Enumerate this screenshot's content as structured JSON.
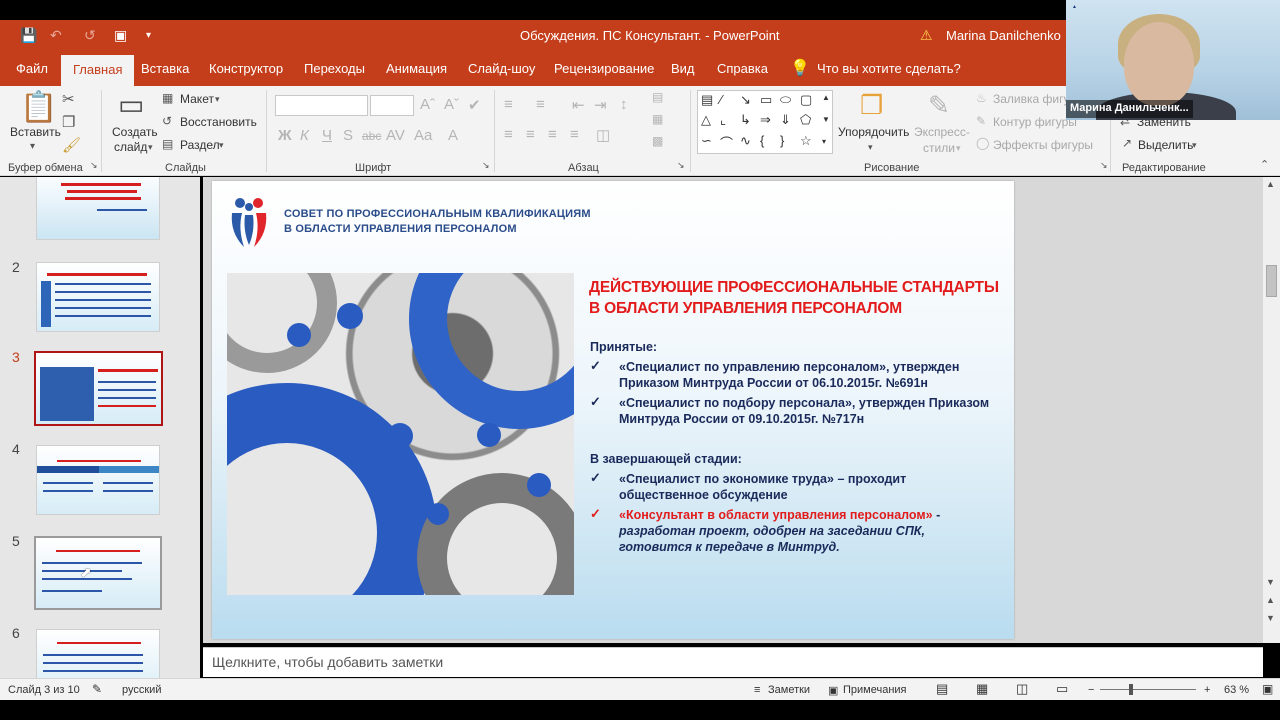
{
  "window": {
    "title": "Обсуждения. ПС Консультант.  -  PowerPoint",
    "user": "Marina Danilchenko"
  },
  "tabs": [
    "Файл",
    "Главная",
    "Вставка",
    "Конструктор",
    "Переходы",
    "Анимация",
    "Слайд-шоу",
    "Рецензирование",
    "Вид",
    "Справка"
  ],
  "tellme": "Что вы хотите сделать?",
  "ribbon": {
    "paste": "Вставить",
    "clipboard_group": "Буфер обмена",
    "new_slide_1": "Создать",
    "new_slide_2": "слайд",
    "layout": "Макет",
    "reset": "Восстановить",
    "section": "Раздел",
    "slides_group": "Слайды",
    "font_group": "Шрифт",
    "paragraph_group": "Абзац",
    "arrange_1": "Упорядочить",
    "quick_styles_1": "Экспресс-",
    "quick_styles_2": "стили",
    "shape_fill": "Заливка фигуры",
    "shape_outline": "Контур фигуры",
    "shape_effects": "Эффекты фигуры",
    "drawing_group": "Рисование",
    "replace": "Заменить",
    "select": "Выделить",
    "editing_group": "Редактирование"
  },
  "webcam": {
    "name": "Марина Данильченк..."
  },
  "thumbnails": [
    {
      "num": "2"
    },
    {
      "num": "3"
    },
    {
      "num": "4"
    },
    {
      "num": "5"
    },
    {
      "num": "6"
    }
  ],
  "slide": {
    "org_line1": "СОВЕТ ПО ПРОФЕССИОНАЛЬНЫМ КВАЛИФИКАЦИЯМ",
    "org_line2": "В ОБЛАСТИ УПРАВЛЕНИЯ ПЕРСОНАЛОМ",
    "heading_line1": "ДЕЙСТВУЮЩИЕ ПРОФЕССИОНАЛЬНЫЕ СТАНДАРТЫ",
    "heading_line2": "В ОБЛАСТИ УПРАВЛЕНИЯ ПЕРСОНАЛОМ",
    "adopted_label": "Принятые:",
    "item1": "«Специалист по управлению персоналом», утвержден Приказом Минтруда России от 06.10.2015г. №691н",
    "item2": "«Специалист по подбору персонала», утвержден Приказом Минтруда России от 09.10.2015г. №717н",
    "final_label": "В завершающей стадии:",
    "item3": "«Специалист по экономике труда» – проходит общественное обсуждение",
    "item4_red": "«Консультант в области управления персоналом»",
    "item4_dash": " -",
    "item4_rest": "разработан проект, одобрен на заседании СПК, готовится к передаче в Минтруд."
  },
  "notes_placeholder": "Щелкните, чтобы добавить заметки",
  "status": {
    "slide_counter": "Слайд 3 из 10",
    "language": "русский",
    "notes": "Заметки",
    "comments": "Примечания",
    "zoom": "63 %"
  },
  "colors": {
    "accent": "#c43e1c",
    "heading_red": "#e21b1b",
    "slide_text": "#1a2a5a"
  }
}
